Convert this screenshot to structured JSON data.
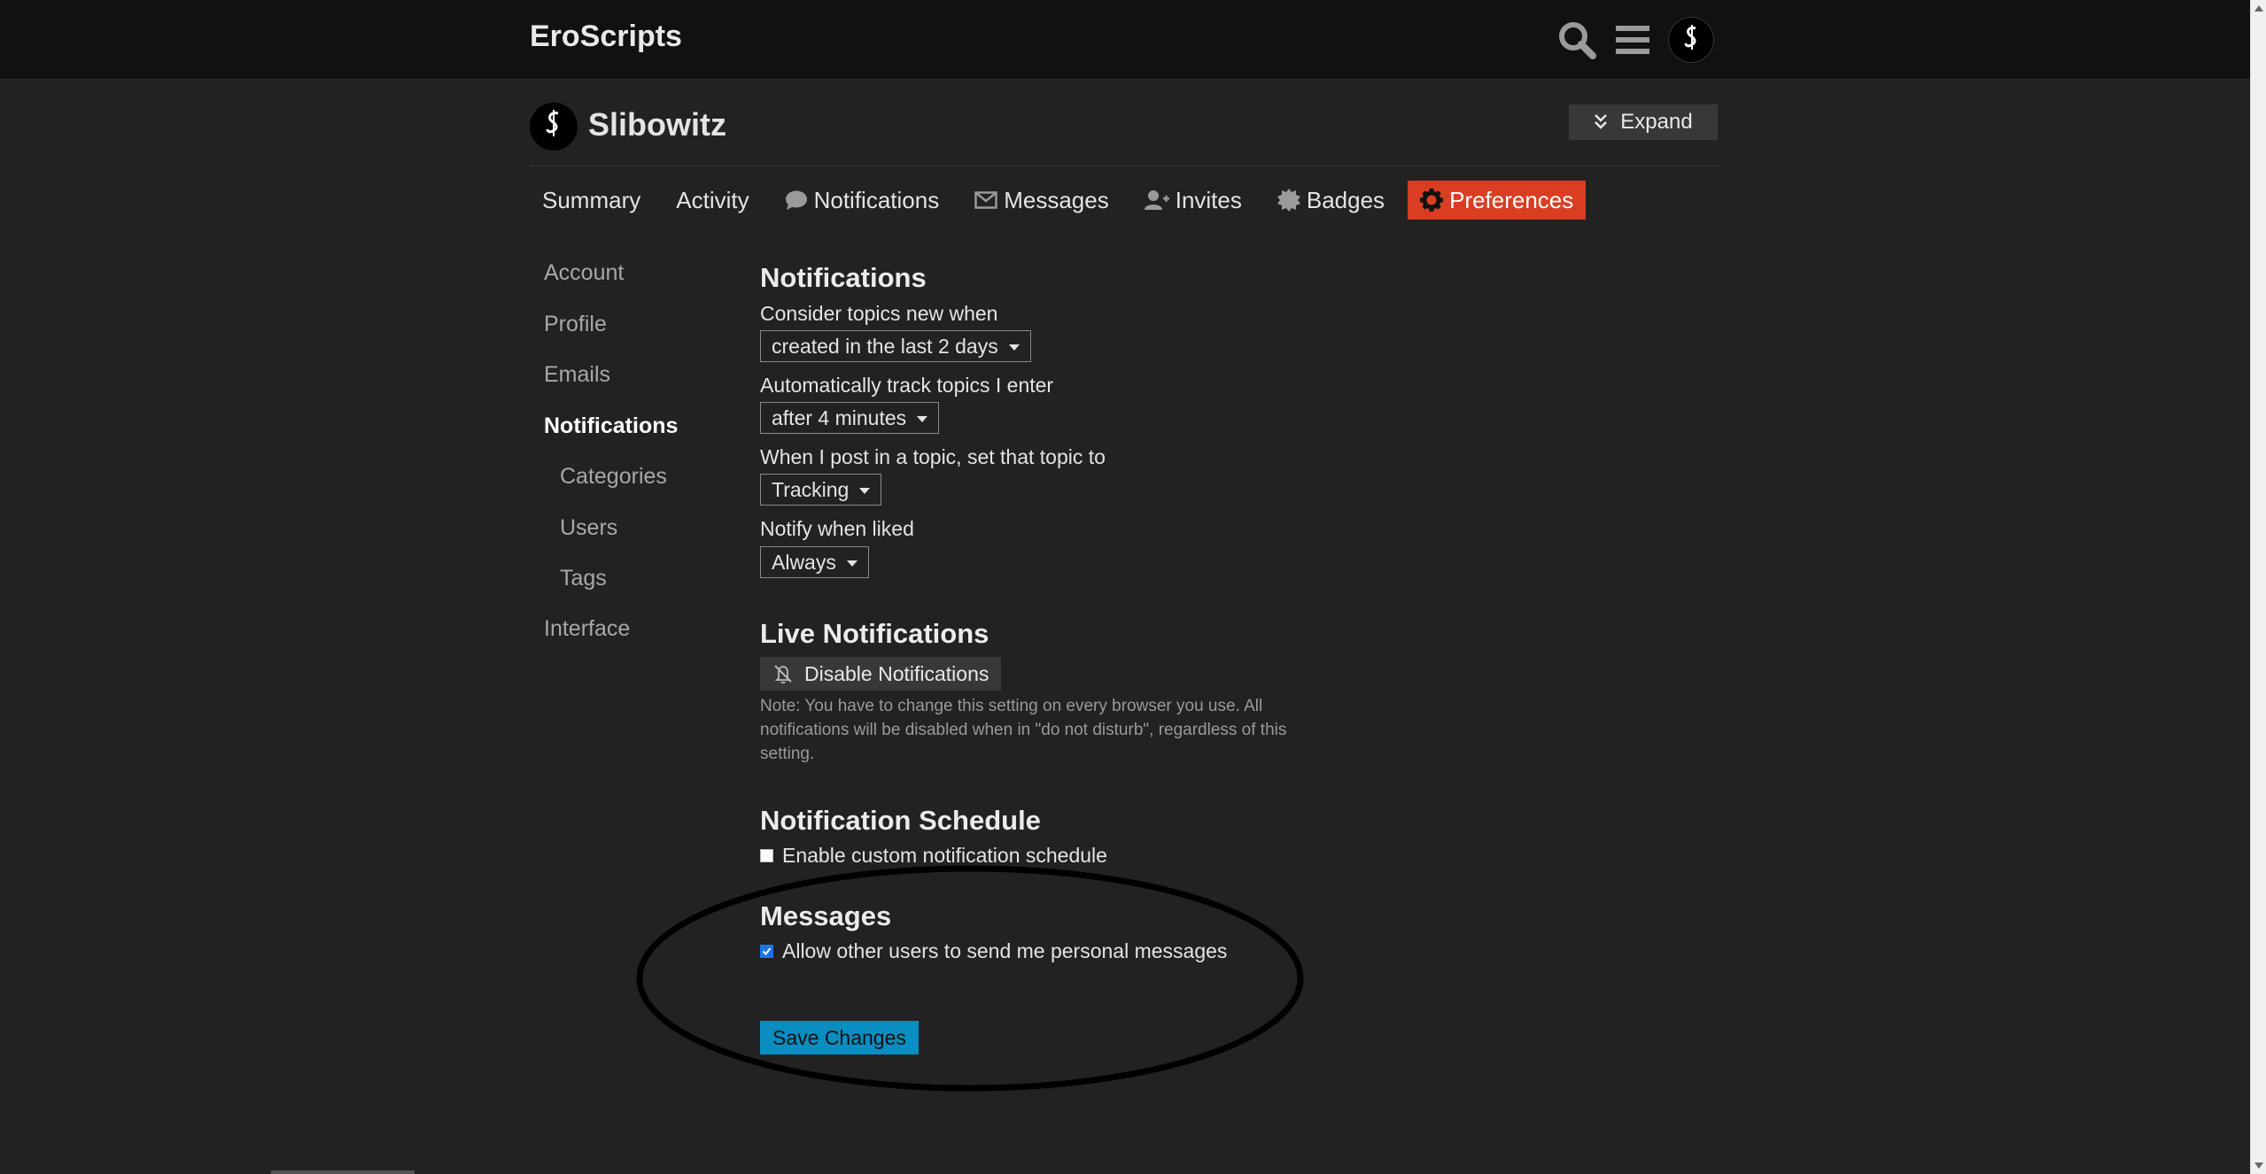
{
  "header": {
    "logo": "EroScripts",
    "icons": [
      "search-icon",
      "hamburger-menu-icon",
      "user-avatar"
    ]
  },
  "user": {
    "name": "Slibowitz",
    "expand_label": "Expand"
  },
  "tabs": [
    {
      "label": "Summary",
      "icon": null,
      "active": false
    },
    {
      "label": "Activity",
      "icon": null,
      "active": false
    },
    {
      "label": "Notifications",
      "icon": "comment-icon",
      "active": false
    },
    {
      "label": "Messages",
      "icon": "envelope-icon",
      "active": false
    },
    {
      "label": "Invites",
      "icon": "user-plus-icon",
      "active": false
    },
    {
      "label": "Badges",
      "icon": "badge-icon",
      "active": false
    },
    {
      "label": "Preferences",
      "icon": "gear-icon",
      "active": true
    }
  ],
  "side_nav": [
    {
      "label": "Account",
      "active": false,
      "sub": false
    },
    {
      "label": "Profile",
      "active": false,
      "sub": false
    },
    {
      "label": "Emails",
      "active": false,
      "sub": false
    },
    {
      "label": "Notifications",
      "active": true,
      "sub": false
    },
    {
      "label": "Categories",
      "active": false,
      "sub": true
    },
    {
      "label": "Users",
      "active": false,
      "sub": true
    },
    {
      "label": "Tags",
      "active": false,
      "sub": true
    },
    {
      "label": "Interface",
      "active": false,
      "sub": false
    }
  ],
  "notifications": {
    "title": "Notifications",
    "fields": [
      {
        "label": "Consider topics new when",
        "value": "created in the last 2 days"
      },
      {
        "label": "Automatically track topics I enter",
        "value": "after 4 minutes"
      },
      {
        "label": "When I post in a topic, set that topic to",
        "value": "Tracking"
      },
      {
        "label": "Notify when liked",
        "value": "Always"
      }
    ]
  },
  "live_notifications": {
    "title": "Live Notifications",
    "button_label": "Disable Notifications",
    "note": "Note: You have to change this setting on every browser you use. All notifications will be disabled when in \"do not disturb\", regardless of this setting."
  },
  "schedule": {
    "title": "Notification Schedule",
    "checkbox_label": "Enable custom notification schedule",
    "checked": false
  },
  "messages": {
    "title": "Messages",
    "checkbox_label": "Allow other users to send me personal messages",
    "checked": true
  },
  "save_label": "Save Changes",
  "colors": {
    "background": "#222222",
    "header": "#111111",
    "active_tab": "#d93e23",
    "save_button": "#0a8dc1",
    "annotation": "#000000"
  }
}
